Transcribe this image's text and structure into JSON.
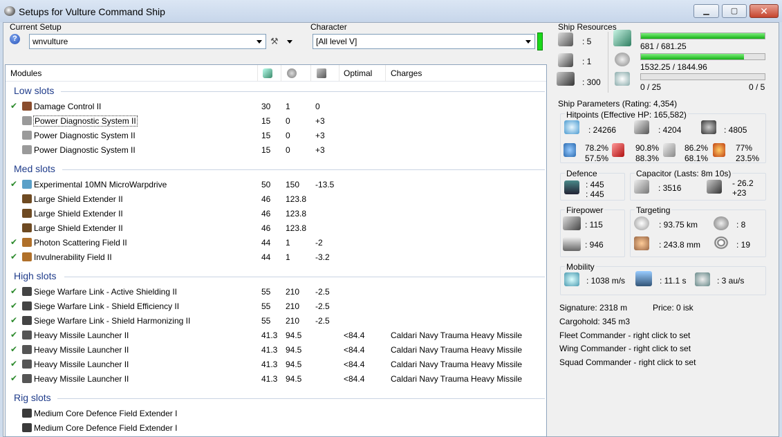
{
  "window": {
    "title": "Setups for Vulture Command Ship",
    "minimize": "▁",
    "maximize": "▢",
    "close": "✕"
  },
  "setup": {
    "label": "Current Setup",
    "help": "?",
    "value": "wnvulture"
  },
  "character": {
    "label": "Character",
    "value": "[All level V]",
    "status_color": "#1bd81b"
  },
  "table": {
    "col_modules": "Modules",
    "col_optimal": "Optimal",
    "col_charges": "Charges"
  },
  "sections": {
    "low": "Low slots",
    "med": "Med slots",
    "high": "High slots",
    "rig": "Rig slots"
  },
  "modules": [
    {
      "check": "✔",
      "name": "Damage Control II",
      "c1": "30",
      "c2": "1",
      "c3": "0",
      "opt": "",
      "charge": "",
      "icon": "#8a4d2e"
    },
    {
      "check": "",
      "name": "Power Diagnostic System II",
      "c1": "15",
      "c2": "0",
      "c3": "+3",
      "opt": "",
      "charge": "",
      "icon": "#9a9a9a"
    },
    {
      "check": "",
      "name": "Power Diagnostic System II",
      "c1": "15",
      "c2": "0",
      "c3": "+3",
      "opt": "",
      "charge": "",
      "icon": "#9a9a9a"
    },
    {
      "check": "",
      "name": "Power Diagnostic System II",
      "c1": "15",
      "c2": "0",
      "c3": "+3",
      "opt": "",
      "charge": "",
      "icon": "#9a9a9a"
    },
    {
      "check": "✔",
      "name": "Experimental 10MN MicroWarpdrive",
      "c1": "50",
      "c2": "150",
      "c3": "-13.5",
      "opt": "",
      "charge": "",
      "icon": "#5aa0c8"
    },
    {
      "check": "",
      "name": "Large Shield Extender II",
      "c1": "46",
      "c2": "123.8",
      "c3": "",
      "opt": "",
      "charge": "",
      "icon": "#6e4a22"
    },
    {
      "check": "",
      "name": "Large Shield Extender II",
      "c1": "46",
      "c2": "123.8",
      "c3": "",
      "opt": "",
      "charge": "",
      "icon": "#6e4a22"
    },
    {
      "check": "",
      "name": "Large Shield Extender II",
      "c1": "46",
      "c2": "123.8",
      "c3": "",
      "opt": "",
      "charge": "",
      "icon": "#6e4a22"
    },
    {
      "check": "✔",
      "name": "Photon Scattering Field II",
      "c1": "44",
      "c2": "1",
      "c3": "-2",
      "opt": "",
      "charge": "",
      "icon": "#b0702a"
    },
    {
      "check": "✔",
      "name": "Invulnerability Field II",
      "c1": "44",
      "c2": "1",
      "c3": "-3.2",
      "opt": "",
      "charge": "",
      "icon": "#b0702a"
    },
    {
      "check": "✔",
      "name": "Siege Warfare Link - Active Shielding II",
      "c1": "55",
      "c2": "210",
      "c3": "-2.5",
      "opt": "",
      "charge": "",
      "icon": "#444"
    },
    {
      "check": "✔",
      "name": "Siege Warfare Link - Shield Efficiency II",
      "c1": "55",
      "c2": "210",
      "c3": "-2.5",
      "opt": "",
      "charge": "",
      "icon": "#444"
    },
    {
      "check": "✔",
      "name": "Siege Warfare Link - Shield Harmonizing II",
      "c1": "55",
      "c2": "210",
      "c3": "-2.5",
      "opt": "",
      "charge": "",
      "icon": "#444"
    },
    {
      "check": "✔",
      "name": "Heavy Missile Launcher II",
      "c1": "41.3",
      "c2": "94.5",
      "c3": "",
      "opt": "<84.4",
      "charge": "Caldari Navy Trauma Heavy Missile",
      "icon": "#555"
    },
    {
      "check": "✔",
      "name": "Heavy Missile Launcher II",
      "c1": "41.3",
      "c2": "94.5",
      "c3": "",
      "opt": "<84.4",
      "charge": "Caldari Navy Trauma Heavy Missile",
      "icon": "#555"
    },
    {
      "check": "✔",
      "name": "Heavy Missile Launcher II",
      "c1": "41.3",
      "c2": "94.5",
      "c3": "",
      "opt": "<84.4",
      "charge": "Caldari Navy Trauma Heavy Missile",
      "icon": "#555"
    },
    {
      "check": "✔",
      "name": "Heavy Missile Launcher II",
      "c1": "41.3",
      "c2": "94.5",
      "c3": "",
      "opt": "<84.4",
      "charge": "Caldari Navy Trauma Heavy Missile",
      "icon": "#555"
    },
    {
      "check": "",
      "name": "Medium Core Defence Field Extender I",
      "c1": "",
      "c2": "",
      "c3": "",
      "opt": "",
      "charge": "",
      "icon": "#3a3a3a"
    },
    {
      "check": "",
      "name": "Medium Core Defence Field Extender I",
      "c1": "",
      "c2": "",
      "c3": "",
      "opt": "",
      "charge": "",
      "icon": "#3a3a3a"
    }
  ],
  "resources": {
    "title": "Ship Resources",
    "turrets": ": 5",
    "launchers": ": 1",
    "calibration": ": 300",
    "cpu": "681 / 681.25",
    "cpu_fraction": 0.9996,
    "power": "1532.25 / 1844.96",
    "power_fraction": 0.8305,
    "drone_bay": "0 / 25",
    "drone_bw": "0 / 5"
  },
  "params": {
    "title": "Ship Parameters (Rating: 4,354)",
    "hitpoints": "Hitpoints (Effective HP: 165,582)",
    "shield_hp": ": 24266",
    "armor_hp": ": 4204",
    "structure_hp": ": 4805",
    "em": [
      "78.2%",
      "57.5%"
    ],
    "thermal": [
      "90.8%",
      "88.3%"
    ],
    "kinetic": [
      "86.2%",
      "68.1%"
    ],
    "explosive": [
      "77%",
      "23.5%"
    ],
    "defence": "Defence",
    "def_a": ": 445",
    "def_b": ": 445",
    "capacitor": "Capacitor (Lasts: 8m 10s)",
    "cap_amount": ": 3516",
    "cap_a": "- 26.2",
    "cap_b": "+23",
    "firepower": "Firepower",
    "fp_a": ": 115",
    "fp_b": ": 946",
    "targeting": "Targeting",
    "range": ": 93.75 km",
    "max_targets": ": 8",
    "scan_res": ": 243.8 mm",
    "sensor": ": 19",
    "mobility": "Mobility",
    "velocity": ": 1038 m/s",
    "align": ": 11.1 s",
    "warp": ": 3 au/s"
  },
  "info": {
    "signature": "Signature: 2318 m",
    "price": "Price: 0 isk",
    "cargo": "Cargohold: 345 m3",
    "fleet": "Fleet Commander - right click to set",
    "wing": "Wing Commander - right click to set",
    "squad": "Squad Commander - right click to set"
  }
}
